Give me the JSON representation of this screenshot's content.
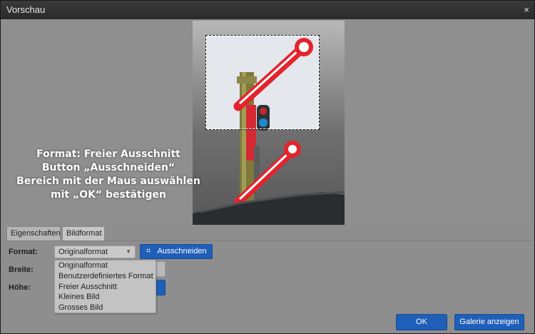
{
  "window": {
    "title": "Vorschau",
    "close_glyph": "×"
  },
  "annotation": {
    "lines": [
      "Format: Freier Ausschnitt",
      "Button „Ausschneiden“",
      "Bereich mit der Maus auswählen",
      "mit „OK“ bestätigen"
    ]
  },
  "tabs": [
    {
      "label": "Eigenschaften"
    },
    {
      "label": "Bildformat"
    }
  ],
  "form": {
    "format_label": "Format:",
    "format_value": "Originalformat",
    "width_label": "Breite:",
    "height_label": "Höhe:",
    "cut_button_label": "Ausschneiden",
    "cut_icon": "crop-icon"
  },
  "dropdown": {
    "options": [
      "Originalformat",
      "Benutzerdefiniertes Format",
      "Freier Ausschnitt",
      "Kleines Bild",
      "Grosses Bild"
    ]
  },
  "footer": {
    "ok_label": "OK",
    "gallery_label": "Galerie anzeigen"
  },
  "colors": {
    "accent": "#1f5fb8",
    "titlebar": "#2a2a2a",
    "signal_red": "#e0202a"
  }
}
